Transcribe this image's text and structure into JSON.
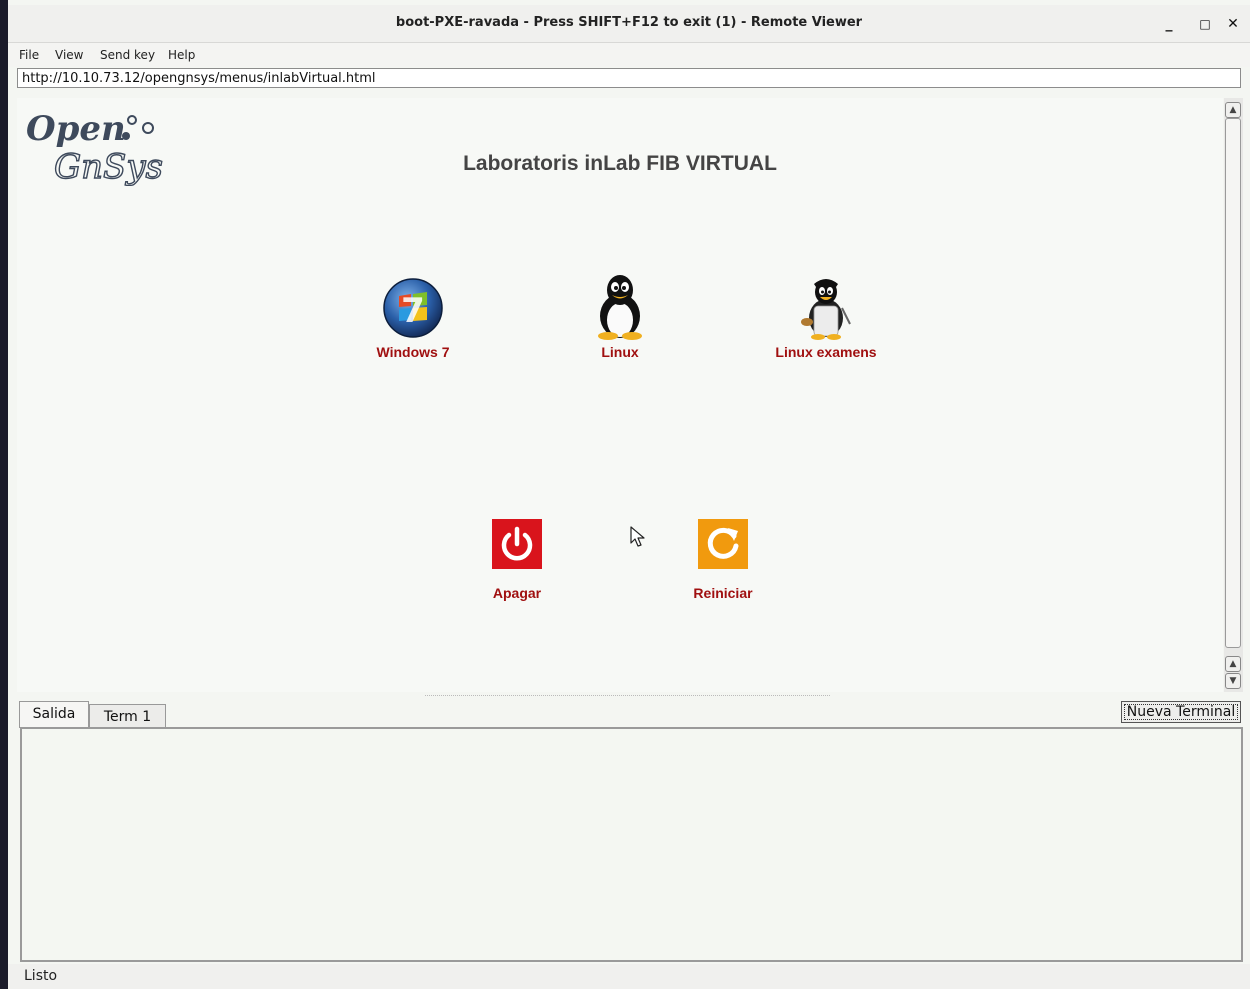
{
  "window": {
    "title": "boot-PXE-ravada - Press SHIFT+F12 to exit (1) - Remote Viewer",
    "minimize": "_",
    "maximize": "□",
    "close": "✕"
  },
  "menubar": {
    "items": [
      {
        "label": "File"
      },
      {
        "label": "View"
      },
      {
        "label": "Send key"
      },
      {
        "label": "Help"
      }
    ]
  },
  "url": "http://10.10.73.12/opengnsys/menus/inlabVirtual.html",
  "logo": {
    "line1": "Open",
    "line2": "GnSys"
  },
  "page_title": "Laboratoris inLab FIB VIRTUAL",
  "os_options": [
    {
      "label": "Windows 7",
      "icon": "windows7-icon"
    },
    {
      "label": "Linux",
      "icon": "tux-icon"
    },
    {
      "label": "Linux examens",
      "icon": "tux-exam-icon"
    }
  ],
  "power_options": [
    {
      "label": "Apagar",
      "icon": "power-icon",
      "color": "#d9141c"
    },
    {
      "label": "Reiniciar",
      "icon": "restart-icon",
      "color": "#f19a0e"
    }
  ],
  "tabs": [
    {
      "label": "Salida"
    },
    {
      "label": "Term 1"
    }
  ],
  "new_terminal_label": "Nueva Terminal",
  "status": "Listo",
  "colors": {
    "accent_label": "#a01010",
    "background": "#f7f9f6"
  }
}
